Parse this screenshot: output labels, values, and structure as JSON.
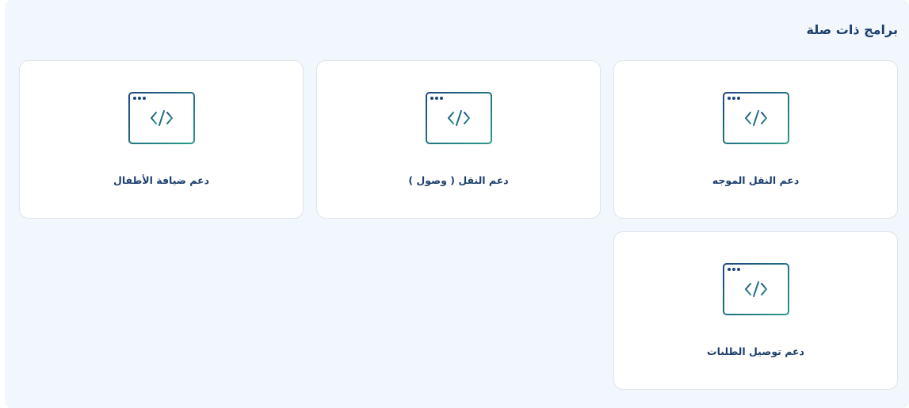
{
  "section": {
    "title": "برامج ذات صلة"
  },
  "programs": [
    {
      "label": "دعم النقل الموجه",
      "icon": "code-window-icon"
    },
    {
      "label": "دعم النقل ( وصول )",
      "icon": "code-window-icon"
    },
    {
      "label": "دعم ضيافة الأطفال",
      "icon": "code-window-icon"
    },
    {
      "label": "دعم توصيل الطلبات",
      "icon": "code-window-icon"
    }
  ],
  "colors": {
    "title": "#1c3f6e",
    "panel_background": "#f2f7fd",
    "icon_gradient_start": "#1e4680",
    "icon_gradient_end": "#2a9a86"
  }
}
